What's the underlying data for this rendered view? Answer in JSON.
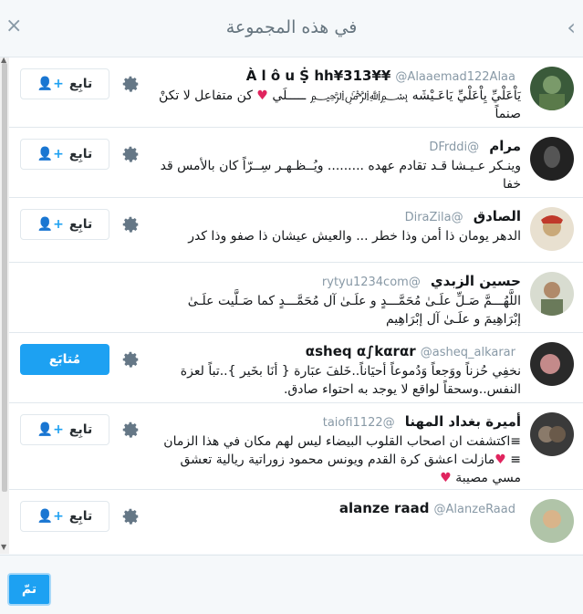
{
  "header": {
    "title": "في هذه المجموعة",
    "close_glyph": "×",
    "back_glyph": "‹"
  },
  "users": [
    {
      "name": "À l ô u Ṩ hh¥313¥¥",
      "handle": "@Alaaemad122Alaa",
      "bio": "يَاْعَلْيِّ يِاْعَلْيِّ يَاعَـيْشَه ﷽ ـــــلَي ♥ كن متفاعل لا تكنْ صنماً",
      "button": "تابِع",
      "following": false
    },
    {
      "name": "مرام",
      "handle": "@DFrddi",
      "bio": "وينـكر عـيـشا قـد تقادم عهده ......... ويُــظـهـر سِــرّاً كان بالأمس قد خفا",
      "button": "تابِع",
      "following": false
    },
    {
      "name": "الصادق",
      "handle": "@DiraZila",
      "bio": "الدهر يومان ذا أمن وذا خطر ... والعيش عيشان ذا صفو وذا كدر",
      "button": "تابِع",
      "following": false
    },
    {
      "name": "حسين الزبدي",
      "handle": "@rytyu1234com",
      "bio": "اللَّهُـــمَّ صَـلِّ علَـىٰ مُحَمَّـــدٍ و علَـىٰ آل مُحَمَّـــدٍ كما صَـلَّيت علَـىٰ إبْرَاهِيمَ و علَـىٰ آل إبْرَاهِيم",
      "button": null,
      "following": false
    },
    {
      "name": "αsheq α∫kαrαr",
      "handle": "@asheq_alkarar",
      "bio": "نخفِي حُزناً ووَجعاً وَدُموعاً أحيَاناً..خَلفَ عبَارة { أنَا بخَير }..تباً لعزة النفس..وسحقاً لواقع لا يوجد به احتواء صادق.",
      "button": "مُتابَع",
      "following": true
    },
    {
      "name": "أميرة بغداد المهنا",
      "handle": "@taiofi1122",
      "bio": "≡اكتشفت ان اصحاب القلوب البيضاء ليس لهم مكان في هذا الزمان ≡ ♥مازلت اعشق كرة القدم ويونس محمود زوراتية ريالية تعشق مسي مصيبة ♥",
      "button": "تابِع",
      "following": false
    },
    {
      "name": "alanze raad",
      "handle": "@AlanzeRaad",
      "bio": "",
      "button": "تابِع",
      "following": false
    }
  ],
  "footer": {
    "done_label": "تمّ"
  },
  "colors": {
    "accent": "#1da1f2",
    "heart": "#e0245e"
  },
  "icons": {
    "gear": "gear-icon",
    "follow": "person-plus-icon"
  }
}
